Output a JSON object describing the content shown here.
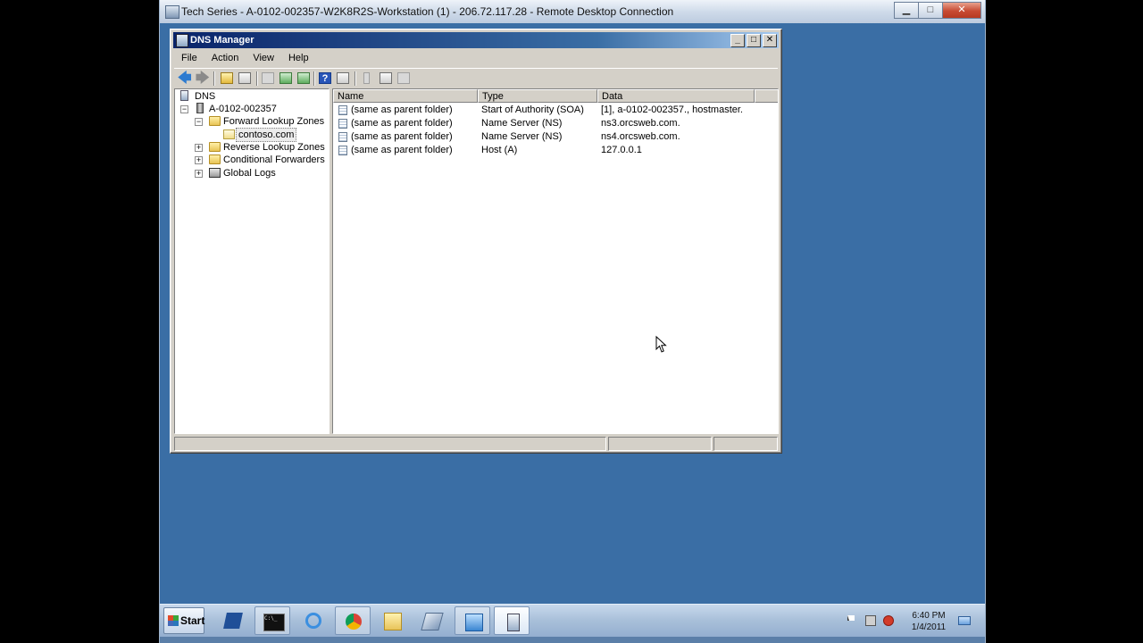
{
  "rdc": {
    "title": "Tech Series - A-0102-002357-W2K8R2S-Workstation (1) - 206.72.117.28 - Remote Desktop Connection",
    "minimize": "▁",
    "maximize": "□",
    "close": "✕"
  },
  "dns_window": {
    "title": "DNS Manager",
    "minimize": "_",
    "maximize": "□",
    "close": "✕",
    "menu": [
      "File",
      "Action",
      "View",
      "Help"
    ],
    "tree": {
      "root": "DNS",
      "server": "A-0102-002357",
      "forward_zones": "Forward Lookup Zones",
      "zone": "contoso.com",
      "reverse_zones": "Reverse Lookup Zones",
      "conditional_forwarders": "Conditional Forwarders",
      "global_logs": "Global Logs",
      "collapse_glyph": "−",
      "expand_glyph": "+"
    },
    "columns": [
      "Name",
      "Type",
      "Data"
    ],
    "records": [
      {
        "name": "(same as parent folder)",
        "type": "Start of Authority (SOA)",
        "data": "[1], a-0102-002357., hostmaster."
      },
      {
        "name": "(same as parent folder)",
        "type": "Name Server (NS)",
        "data": "ns3.orcsweb.com."
      },
      {
        "name": "(same as parent folder)",
        "type": "Name Server (NS)",
        "data": "ns4.orcsweb.com."
      },
      {
        "name": "(same as parent folder)",
        "type": "Host (A)",
        "data": "127.0.0.1"
      }
    ]
  },
  "taskbar": {
    "start_label": "Start",
    "clock_time": "6:40 PM",
    "clock_date": "1/4/2011",
    "cmd_glyph": "C:\\_"
  },
  "icons": {
    "back": "back-arrow-icon",
    "forward": "forward-arrow-icon"
  }
}
